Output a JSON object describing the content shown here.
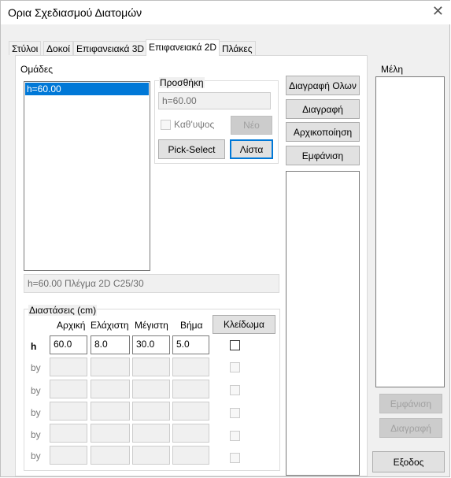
{
  "window": {
    "title": "Ορια Σχεδιασμού Διατομών",
    "close_symbol": "✕"
  },
  "tabs": [
    {
      "label": "Στύλοι"
    },
    {
      "label": "Δοκοί"
    },
    {
      "label": "Επιφανειακά 3D"
    },
    {
      "label": "Επιφανειακά 2D",
      "active": true
    },
    {
      "label": "Πλάκες"
    }
  ],
  "groups": {
    "label": "Ομάδες",
    "items": [
      "h=60.00"
    ],
    "selected": "h=60.00",
    "status": "h=60.00 Πλέγμα 2D C25/30"
  },
  "add": {
    "label": "Προσθήκη",
    "value": "h=60.00",
    "vertical_label": "Καθ'υψος",
    "new_button": "Νέο",
    "pick_button": "Pick-Select",
    "list_button": "Λίστα"
  },
  "actions": {
    "delete_all": "Διαγραφή Ολων",
    "delete": "Διαγραφή",
    "init": "Αρχικοποίηση",
    "show": "Εμφάνιση"
  },
  "members": {
    "label": "Μέλη",
    "show_button": "Εμφάνιση",
    "delete_button": "Διαγραφή",
    "exit_button": "Εξοδος"
  },
  "dims": {
    "label": "Διαστάσεις (cm)",
    "headers": [
      "Αρχική",
      "Ελάχιστη",
      "Μέγιστη",
      "Βήμα"
    ],
    "lock_button": "Κλείδωμα",
    "rows": [
      {
        "name": "h",
        "values": [
          "60.0",
          "8.0",
          "30.0",
          "5.0"
        ],
        "enabled": true,
        "locked": false
      },
      {
        "name": "by",
        "values": [
          "",
          "",
          "",
          ""
        ],
        "enabled": false,
        "locked": false
      },
      {
        "name": "by",
        "values": [
          "",
          "",
          "",
          ""
        ],
        "enabled": false,
        "locked": false
      },
      {
        "name": "by",
        "values": [
          "",
          "",
          "",
          ""
        ],
        "enabled": false,
        "locked": false
      },
      {
        "name": "by",
        "values": [
          "",
          "",
          "",
          ""
        ],
        "enabled": false,
        "locked": false
      },
      {
        "name": "by",
        "values": [
          "",
          "",
          "",
          ""
        ],
        "enabled": false,
        "locked": false
      }
    ]
  },
  "colors": {
    "selection": "#0078d7",
    "focus_border": "#0078d7"
  }
}
